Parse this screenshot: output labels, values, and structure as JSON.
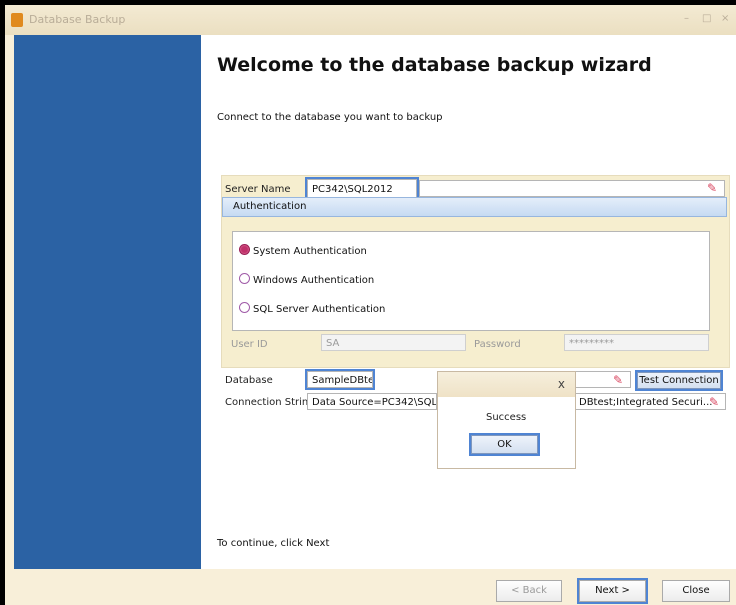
{
  "window": {
    "title": "Database Backup",
    "controls": {
      "minimize": "–",
      "maximize": "□",
      "close": "×"
    }
  },
  "main": {
    "heading": "Welcome to the database backup wizard",
    "subtitle": "Connect to the database you want to backup",
    "continue_text": "To continue, click Next"
  },
  "form": {
    "server_name_label": "Server Name",
    "server_name_value": "PC342\\SQL2012",
    "authentication_header": "Authentication",
    "auth_options": [
      {
        "label": "System Authentication",
        "selected": true
      },
      {
        "label": "Windows Authentication",
        "selected": false
      },
      {
        "label": "SQL Server Authentication",
        "selected": false
      }
    ],
    "user_id_label": "User ID",
    "user_id_value": "SA",
    "password_label": "Password",
    "password_value": "*********",
    "database_label": "Database",
    "database_value": "SampleDBtest",
    "test_connection_label": "Test Connection",
    "connection_string_label": "Connection String",
    "connection_string_left": "Data Source=PC342\\SQL",
    "connection_string_right": "DBtest;Integrated Securi..."
  },
  "popup": {
    "close": "x",
    "message": "Success",
    "ok_label": "OK"
  },
  "footer": {
    "back_label": "< Back",
    "next_label": "Next >",
    "close_label": "Close"
  },
  "colors": {
    "sidebar": "#2b62a4",
    "highlight": "#4f84d3",
    "selected_radio": "#c0316a"
  },
  "icons": [
    "database-icon",
    "eraser-icon",
    "radio-selected-icon",
    "radio-icon"
  ]
}
